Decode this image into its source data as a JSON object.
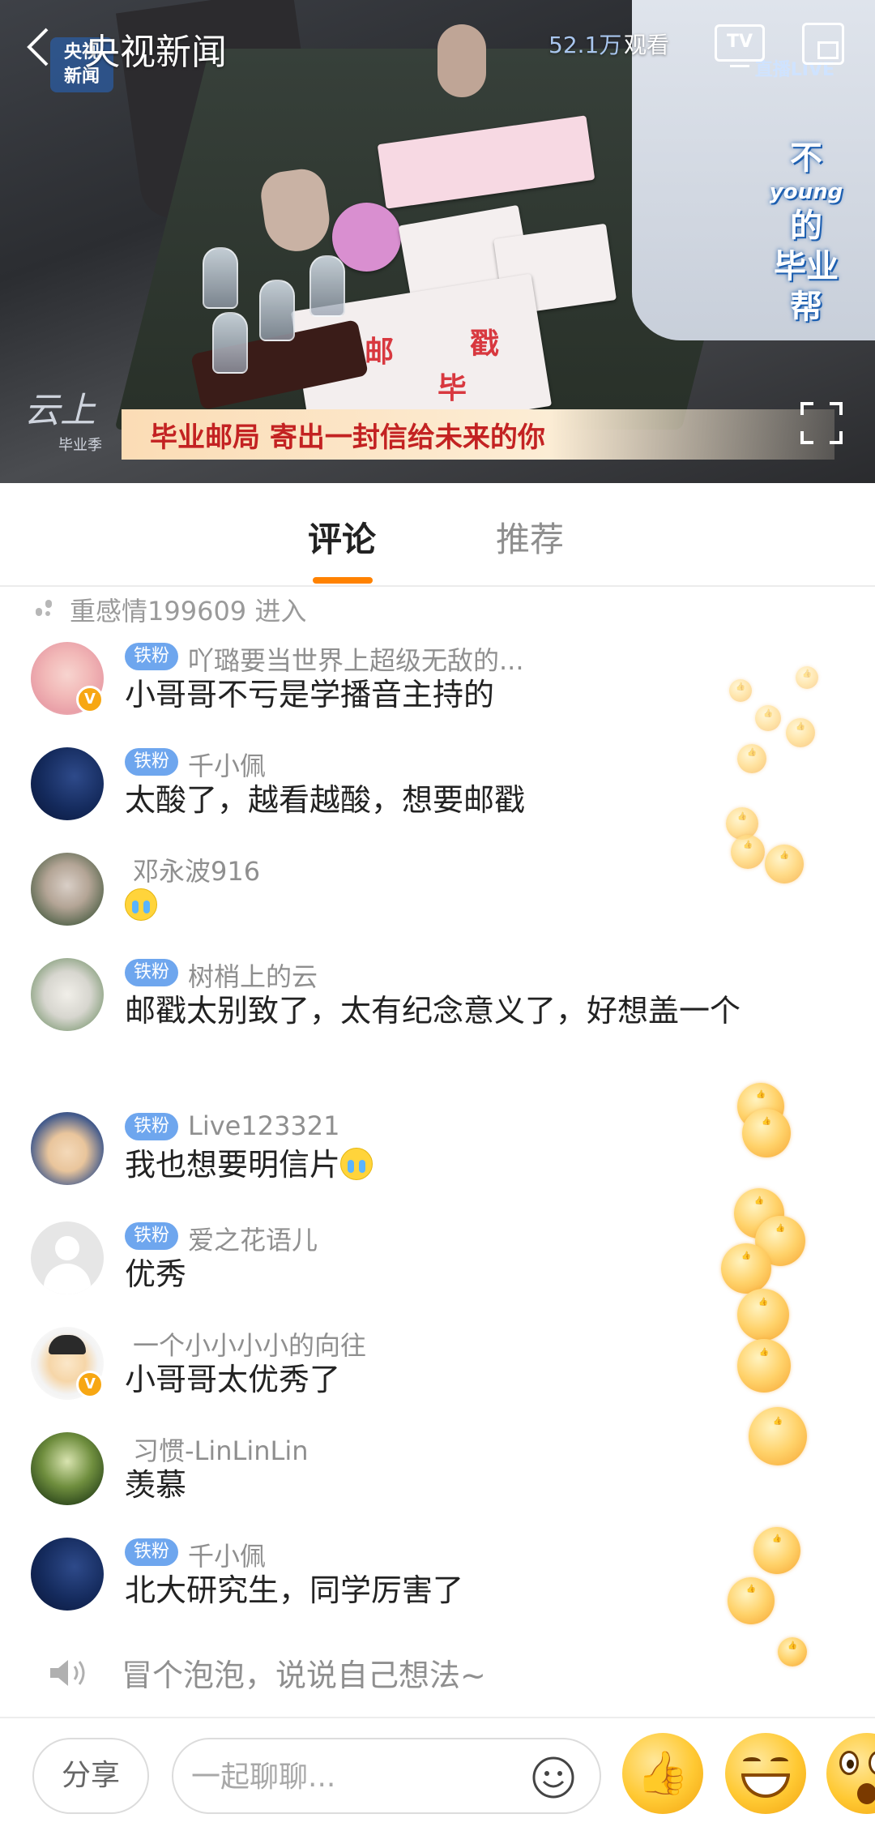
{
  "video": {
    "channel_title": "央视新闻",
    "viewer_count": "52.1万",
    "viewer_label": "观看",
    "tv_label": "TV",
    "cctv_logo_line1": "央视",
    "cctv_logo_line2": "新闻",
    "live_logo": "直播LIVE",
    "banner_text": "毕业邮局 寄出一封信给未来的你",
    "vertical_title": [
      "不",
      "young",
      "的",
      "毕业",
      "帮"
    ],
    "cloud_logo": "云上",
    "cloud_sub": "毕业季",
    "stamp_text": [
      "邮",
      "戳",
      "毕"
    ]
  },
  "tabs": [
    {
      "label": "评论",
      "active": true
    },
    {
      "label": "推荐",
      "active": false
    }
  ],
  "enter_notice": "重感情199609 进入",
  "comments": [
    {
      "fan_badge": "铁粉",
      "username": "吖璐要当世界上超级无敌的...",
      "message": "小哥哥不亏是学播音主持的",
      "verified": true,
      "avatar": "girl-pink"
    },
    {
      "fan_badge": "铁粉",
      "username": "千小佩",
      "message": "太酸了，越看越酸，想要邮戳",
      "verified": false,
      "avatar": "night-sky"
    },
    {
      "fan_badge": "",
      "username": "邓永波916",
      "message": "",
      "emoji": "crying-emoji",
      "verified": false,
      "avatar": "man-mask"
    },
    {
      "fan_badge": "铁粉",
      "username": "树梢上的云",
      "message": "邮戳太别致了，太有纪念意义了，好想盖一个",
      "verified": false,
      "avatar": "kid-drawing"
    },
    {
      "fan_badge": "铁粉",
      "username": "Live123321",
      "message": "我也想要明信片",
      "emoji": "crying-emoji",
      "verified": false,
      "avatar": "child-yellow"
    },
    {
      "fan_badge": "铁粉",
      "username": "爱之花语儿",
      "message": "优秀",
      "verified": false,
      "avatar": "default-gray"
    },
    {
      "fan_badge": "",
      "username": "一个小小小小的向往",
      "message": "小哥哥太优秀了",
      "verified": true,
      "avatar": "cartoon-boy"
    },
    {
      "fan_badge": "",
      "username": "习惯-LinLinLin",
      "message": "羡慕",
      "verified": false,
      "avatar": "forest-green"
    },
    {
      "fan_badge": "铁粉",
      "username": "千小佩",
      "message": "北大研究生，同学厉害了",
      "verified": false,
      "avatar": "night-sky"
    }
  ],
  "bubble_prompt": "冒个泡泡，说说自己想法~",
  "bottom": {
    "share_label": "分享",
    "chat_placeholder": "一起聊聊..."
  },
  "colors": {
    "accent_orange": "#ff8200",
    "fan_badge_blue": "#6ea6ee",
    "verified_gold": "#f7a713"
  },
  "icons": [
    "back-arrow-icon",
    "tv-icon",
    "picture-in-picture-icon",
    "fullscreen-icon",
    "enter-footprint-icon",
    "speaker-icon",
    "smile-icon",
    "thumbs-up-icon",
    "grin-emoji-icon",
    "wow-emoji-icon"
  ]
}
